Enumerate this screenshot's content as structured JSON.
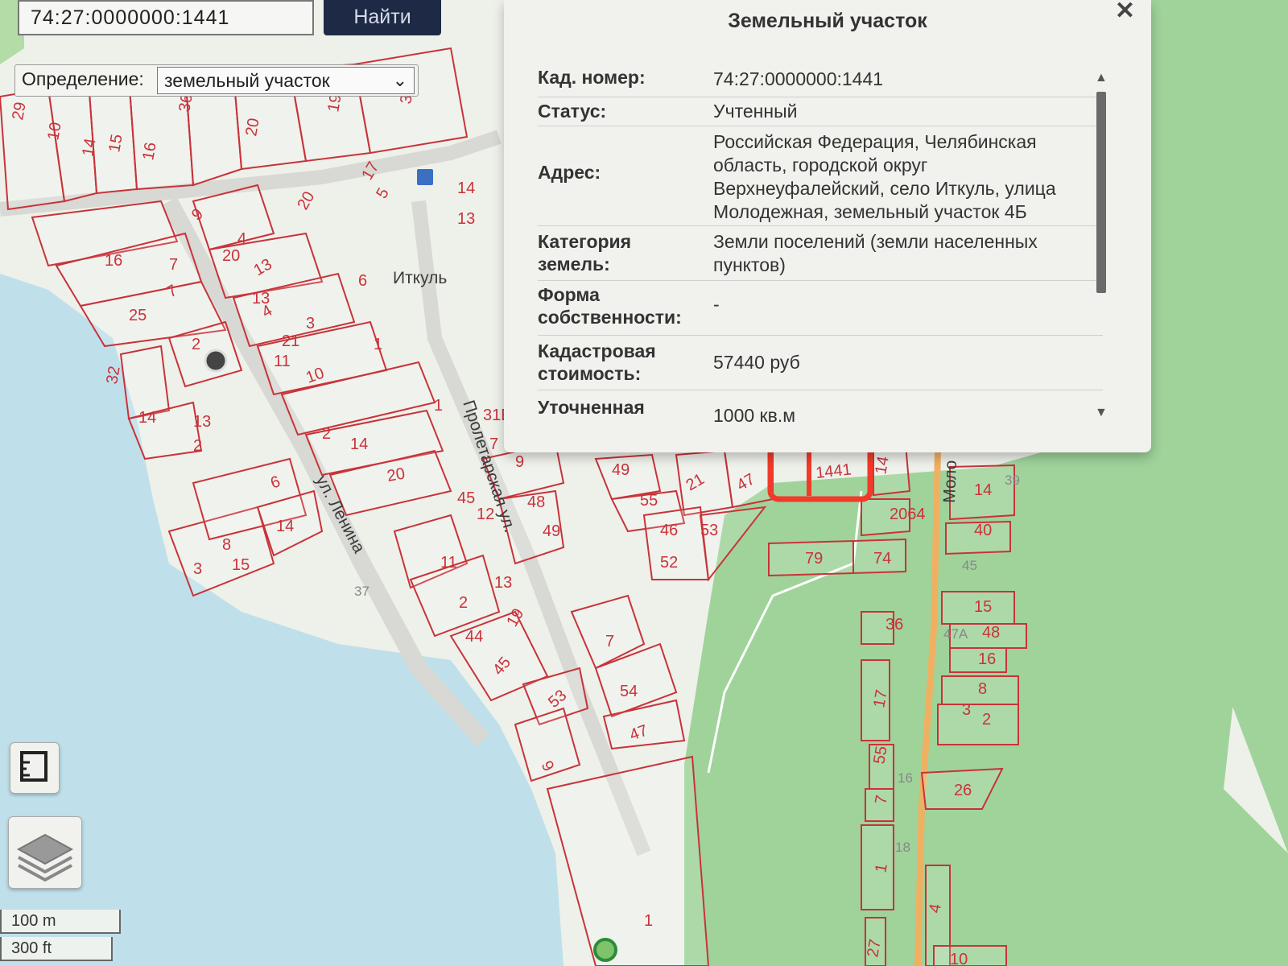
{
  "search": {
    "value": "74:27:0000000:1441",
    "button_label": "Найти"
  },
  "definition": {
    "label": "Определение:",
    "selected": "земельный участок"
  },
  "popup": {
    "title": "Земельный участок",
    "rows": [
      {
        "label": "Кад. номер:",
        "value": "74:27:0000000:1441"
      },
      {
        "label": "Статус:",
        "value": "Учтенный"
      },
      {
        "label": "Адрес:",
        "value": "Российская Федерация, Челябинская область, городской округ Верхнеуфалейский, село Иткуль, улица Молодежная, земельный участок 4Б"
      },
      {
        "label": "Категория земель:",
        "value": "Земли поселений (земли населенных пунктов)"
      },
      {
        "label": "Форма собственности:",
        "value": "-"
      },
      {
        "label": "Кадастровая стоимость:",
        "value": "57440 руб"
      },
      {
        "label": "Уточненная",
        "value": "1000 кв.м"
      }
    ]
  },
  "map": {
    "village_label": "Иткуль",
    "streets": [
      "ул. Ленина",
      "Пролетарская ул.",
      "Моло"
    ],
    "highlighted_plot": "1441",
    "plot_labels": [
      "29",
      "10",
      "14",
      "15",
      "16",
      "36",
      "20",
      "19",
      "3",
      "9",
      "20",
      "5",
      "17",
      "14",
      "13",
      "16",
      "4",
      "7",
      "7",
      "25",
      "2",
      "32",
      "14",
      "13",
      "2",
      "6",
      "13",
      "4",
      "3",
      "1",
      "10",
      "11",
      "2",
      "14",
      "20",
      "1",
      "6",
      "14",
      "8",
      "15",
      "3",
      "31Б",
      "7",
      "9",
      "48",
      "49",
      "45",
      "12",
      "11",
      "13",
      "2",
      "19",
      "44",
      "45",
      "53",
      "7",
      "54",
      "47",
      "9",
      "1",
      "49",
      "55",
      "21",
      "47",
      "46",
      "52",
      "53",
      "14",
      "14",
      "2064",
      "40",
      "79",
      "74",
      "15",
      "48",
      "36",
      "16",
      "8",
      "2",
      "3",
      "17",
      "7",
      "55",
      "1",
      "26",
      "4",
      "27",
      "10",
      "20",
      "13",
      "21"
    ],
    "grey_labels": [
      "37",
      "39",
      "45",
      "47А",
      "16",
      "18"
    ],
    "scale": {
      "metric": "100 m",
      "imperial": "300 ft"
    }
  },
  "colors": {
    "water": "#bfe0ea",
    "forest": "#9fd39a",
    "land": "#eef0ea",
    "plot_outline": "#c8333a",
    "highlight": "#f23a2a",
    "search_button": "#1e2a45"
  }
}
